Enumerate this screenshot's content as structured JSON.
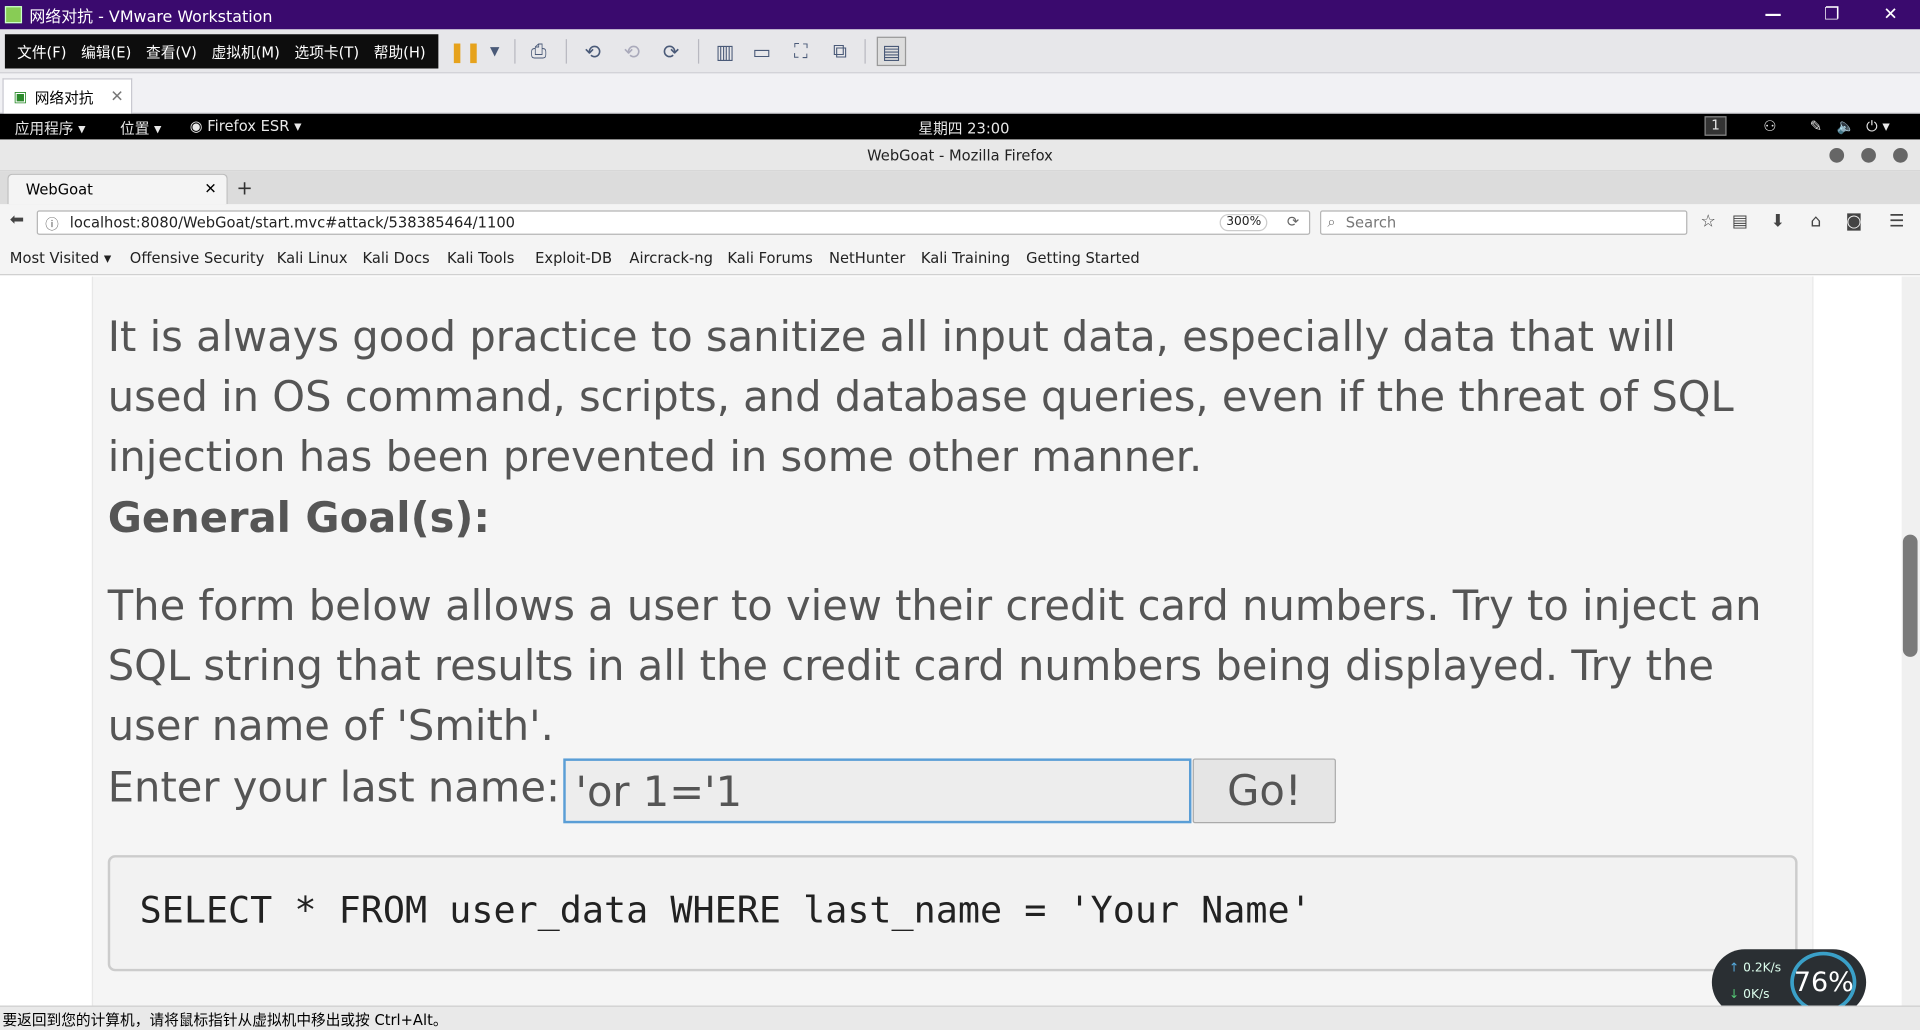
{
  "vmware": {
    "title": "网络对抗 - VMware Workstation",
    "menu": [
      "文件(F)",
      "编辑(E)",
      "查看(V)",
      "虚拟机(M)",
      "选项卡(T)",
      "帮助(H)"
    ],
    "tab_label": "网络对抗",
    "status_text": "要返回到您的计算机，请将鼠标指针从虚拟机中移出或按 Ctrl+Alt。"
  },
  "kali_panel": {
    "apps": "应用程序 ▾",
    "places": "位置 ▾",
    "browser": "Firefox ESR ▾",
    "clock": "星期四 23:00",
    "workspace": "1"
  },
  "firefox": {
    "window_title": "WebGoat - Mozilla Firefox",
    "tab_title": "WebGoat",
    "url": "localhost:8080/WebGoat/start.mvc#attack/538385464/1100",
    "zoom": "300%",
    "search_placeholder": "Search",
    "bookmarks": [
      "Most Visited ▾",
      "Offensive Security",
      "Kali Linux",
      "Kali Docs",
      "Kali Tools",
      "Exploit-DB",
      "Aircrack-ng",
      "Kali Forums",
      "NetHunter",
      "Kali Training",
      "Getting Started"
    ]
  },
  "page": {
    "para1_lines": [
      "It is always good practice to sanitize all input data, especially data that will",
      "used in OS command, scripts, and database queries, even if the threat of SQL",
      "injection has been prevented in some other manner."
    ],
    "goal_heading": "General Goal(s):",
    "para2_lines": [
      "The form below allows a user to view their credit card numbers. Try to inject an",
      "SQL string that results in all the credit card numbers being displayed. Try the",
      "user name of 'Smith'."
    ],
    "name_label": "Enter your last name:",
    "name_value": "'or 1='1",
    "go_label": "Go!",
    "sql_text": "SELECT * FROM user_data WHERE last_name = 'Your Name'"
  },
  "net_widget": {
    "up": "0.2K/s",
    "down": "0K/s",
    "percent": "76%"
  }
}
